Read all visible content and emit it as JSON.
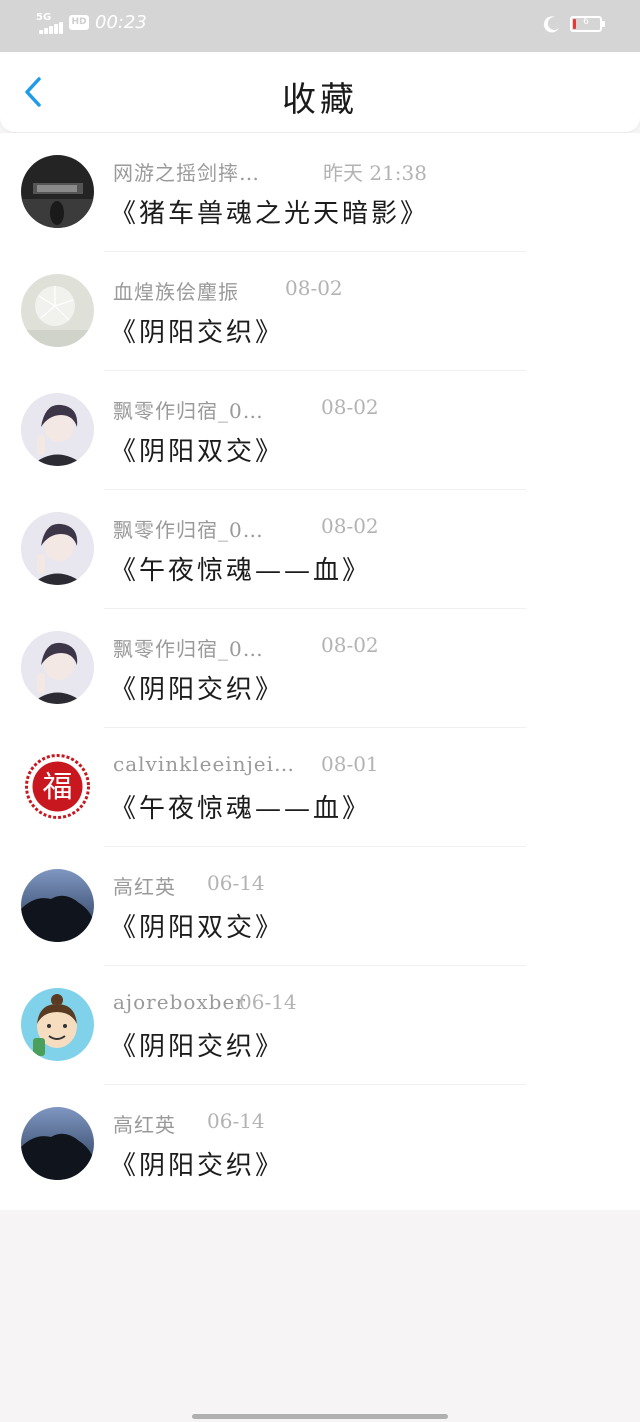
{
  "status_bar": {
    "network": "5G",
    "hd": "HD",
    "time": "00:23",
    "battery": "6",
    "icons": [
      "signal-icon",
      "moon-icon",
      "battery-icon"
    ]
  },
  "header": {
    "back_icon": "chevron-left-icon",
    "title": "收藏"
  },
  "favorites": [
    {
      "user": "网游之摇剑摔…",
      "date": "昨天 21:38",
      "title": "《猪车兽魂之光天暗影》",
      "avatar": "dark-square-logo"
    },
    {
      "user": "血煌族侩麈振",
      "date": "08-02",
      "title": "《阴阳交织》",
      "avatar": "dandelion"
    },
    {
      "user": "飘零作归宿_0…",
      "date": "08-02",
      "title": "《阴阳双交》",
      "avatar": "anime-boy"
    },
    {
      "user": "飘零作归宿_0…",
      "date": "08-02",
      "title": "《午夜惊魂——血》",
      "avatar": "anime-boy"
    },
    {
      "user": "飘零作归宿_0…",
      "date": "08-02",
      "title": "《阴阳交织》",
      "avatar": "anime-boy"
    },
    {
      "user": "calvinkleeinjei…",
      "date": "08-01",
      "title": "《午夜惊魂——血》",
      "avatar": "fu-seal",
      "avatar_text": "福"
    },
    {
      "user": "高红英",
      "date": "06-14",
      "title": "《阴阳双交》",
      "avatar": "night-tree"
    },
    {
      "user": "ajoreboxber",
      "date": "06-14",
      "title": "《阴阳交织》",
      "avatar": "cartoon-girl"
    },
    {
      "user": "高红英",
      "date": "06-14",
      "title": "《阴阳交织》",
      "avatar": "night-tree"
    }
  ],
  "colors": {
    "accent": "#1e9be9",
    "status_bar": "#d5d5d5",
    "background": "#f6f4f4",
    "battery_low": "#e53935"
  }
}
